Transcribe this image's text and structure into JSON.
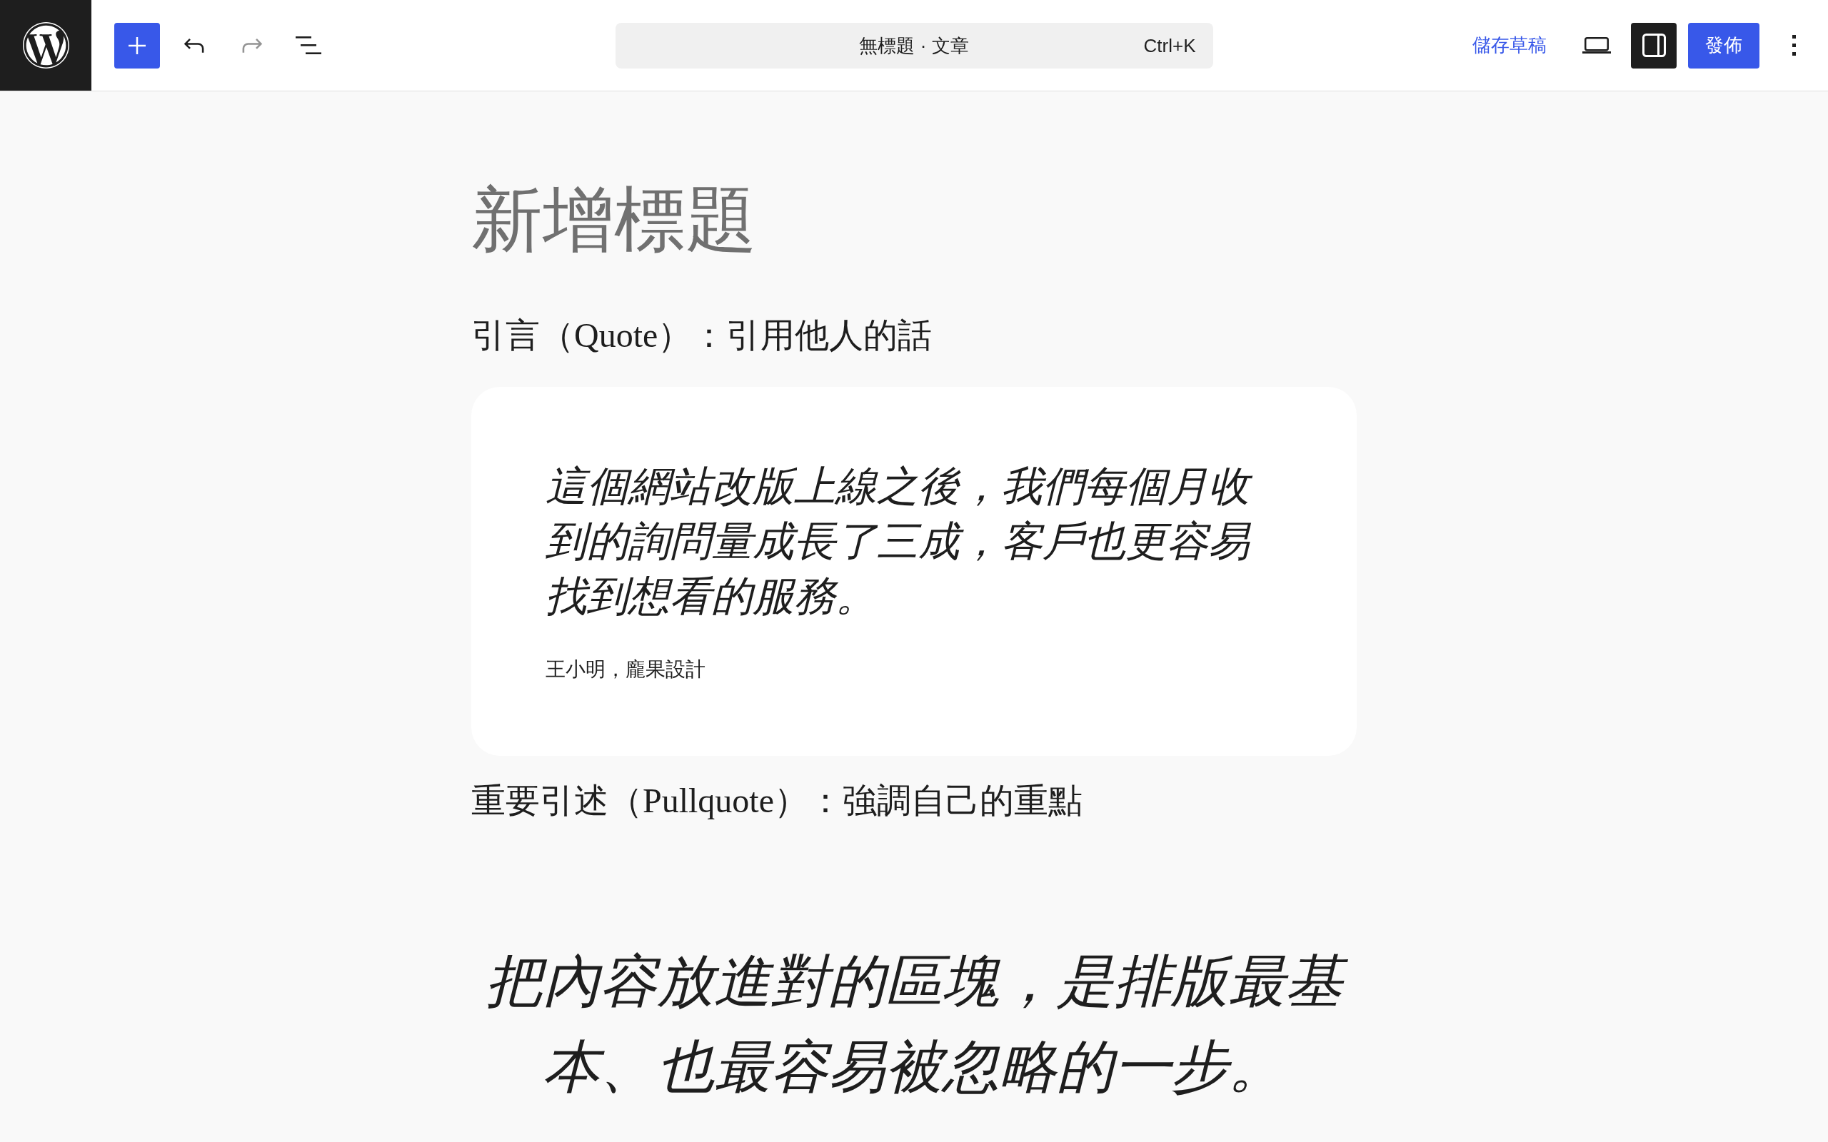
{
  "header": {
    "history": [
      {
        "kind": "undo",
        "disabled": false
      },
      {
        "kind": "redo",
        "disabled": true
      }
    ],
    "command_bar": {
      "title": "無標題 · 文章",
      "shortcut": "Ctrl+K"
    },
    "save_draft": "儲存草稿",
    "settings_toggle": {
      "pressed": true
    },
    "publish": "發佈"
  },
  "editor": {
    "title": {
      "placeholder": "新增標題"
    },
    "blocks": [
      {
        "kind": "paragraph",
        "text": "引言（Quote）：引用他人的話"
      },
      {
        "kind": "quote",
        "text": "這個網站改版上線之後，我們每個月收到的詢問量成長了三成，客戶也更容易找到想看的服務。",
        "citation": "王小明，龐果設計"
      },
      {
        "kind": "paragraph",
        "text": "重要引述（Pullquote）：強調自己的重點"
      },
      {
        "kind": "pullquote",
        "text": "把內容放進對的區塊，是排版最基本、也最容易被忽略的一步。"
      }
    ]
  }
}
